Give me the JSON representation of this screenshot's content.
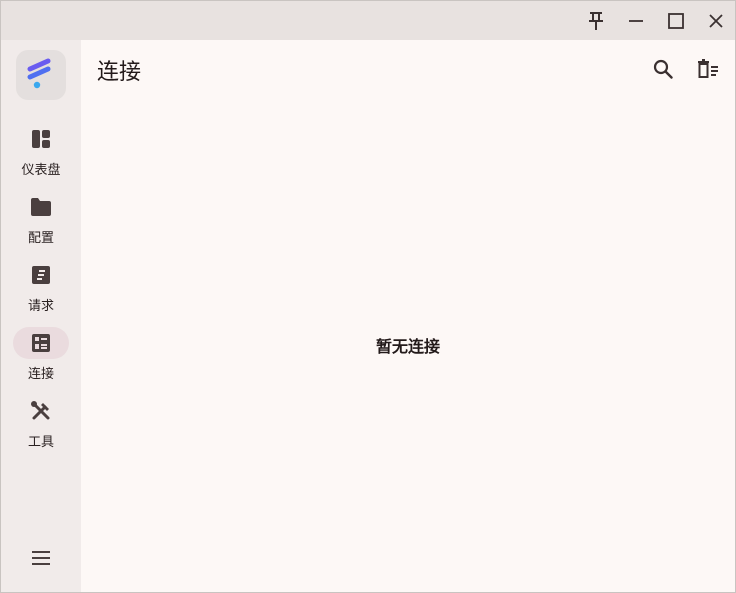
{
  "titlebar": {
    "buttons": [
      {
        "name": "pin",
        "icon": "pin-icon"
      },
      {
        "name": "minimize",
        "icon": "minimize-icon"
      },
      {
        "name": "maximize",
        "icon": "maximize-icon"
      },
      {
        "name": "close",
        "icon": "close-icon"
      }
    ]
  },
  "sidebar": {
    "logo_icon": "app-logo-icon",
    "items": [
      {
        "label": "仪表盘",
        "icon": "dashboard-icon",
        "active": false
      },
      {
        "label": "配置",
        "icon": "folder-icon",
        "active": false
      },
      {
        "label": "请求",
        "icon": "request-icon",
        "active": false
      },
      {
        "label": "连接",
        "icon": "connections-icon",
        "active": true
      },
      {
        "label": "工具",
        "icon": "tools-icon",
        "active": false
      }
    ],
    "menu_icon": "hamburger-menu-icon"
  },
  "main": {
    "title": "连接",
    "actions": [
      {
        "name": "search",
        "icon": "search-icon"
      },
      {
        "name": "clear-all",
        "icon": "clear-all-icon"
      }
    ],
    "empty_message": "暂无连接"
  },
  "colors": {
    "accent": "#5b6bf0",
    "active_bg": "#eadbde",
    "sidebar_bg": "#f1ebea",
    "main_bg": "#fdf8f6",
    "icon_color": "#4a3f3f"
  }
}
